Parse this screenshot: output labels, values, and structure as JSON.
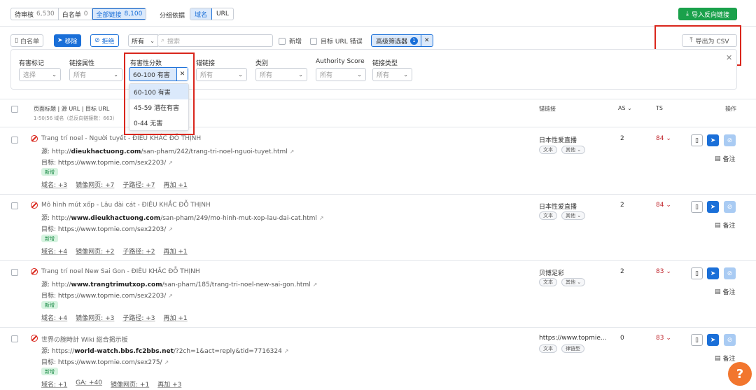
{
  "tabs": {
    "pending": {
      "label": "待审核",
      "count": "6,530"
    },
    "whitelist": {
      "label": "白名单",
      "count": "0"
    },
    "all": {
      "label": "全部链接",
      "count": "8,100"
    }
  },
  "group": {
    "label": "分组依据",
    "domain": "域名",
    "url": "URL"
  },
  "import_label": "导入反向链接",
  "toolbar": {
    "whitelist": "白名单",
    "remove": "移除",
    "reject": "拒绝",
    "scope": "所有",
    "search_placeholder": "搜索",
    "new": "新增",
    "target_error": "目标 URL 错误",
    "advanced": "高级筛选器",
    "advanced_count": "1",
    "export": "导出为 CSV"
  },
  "filters": {
    "toxic_mark": {
      "label": "有害标记",
      "value": "选择"
    },
    "link_attr": {
      "label": "链接属性",
      "value": "所有"
    },
    "toxic_score": {
      "label": "有害性分数",
      "value": "60-100 有害"
    },
    "anchor": {
      "label": "锚链接",
      "value": "所有"
    },
    "category": {
      "label": "类别",
      "value": "所有"
    },
    "authority": {
      "label": "Authority Score",
      "value": "所有"
    },
    "link_type": {
      "label": "链接类型",
      "value": "所有"
    }
  },
  "dropdown": [
    "60-100 有害",
    "45-59 潜在有害",
    "0-44 无害"
  ],
  "table": {
    "col_page": "页面标题 | 源 URL | 目标 URL",
    "col_page_sub": "1-50/56 域名（总反向链接数：663）",
    "col_anchor": "锚链接",
    "col_as": "AS",
    "col_ts": "TS",
    "col_actions": "操作"
  },
  "labels": {
    "src": "源:",
    "target": "目标:",
    "new_tag": "新增",
    "note": "备注"
  },
  "rows": [
    {
      "title": "Trang trí noel - Người tuyết - ĐIÊU KHẮC ĐỖ THỊNH",
      "src_pre": "http://",
      "src_domain": "dieukhactuong.com",
      "src_path": "/san-pham/242/trang-tri-noel-nguoi-tuyet.html",
      "target": "https://www.topmie.com/sex2203/",
      "anchor": "日本性爱直播",
      "pill1": "文本",
      "pill2": "其他",
      "as": "2",
      "ts": "84",
      "links": [
        "域名: +3",
        "镜像网页: +7",
        "子路径: +7",
        "再加 +1"
      ]
    },
    {
      "title": "Mô hình mút xốp - Lâu đài cát - ĐIÊU KHẮC ĐỖ THỊNH",
      "src_pre": "http://",
      "src_domain": "www.dieukhactuong.com",
      "src_path": "/san-pham/249/mo-hinh-mut-xop-lau-dai-cat.html",
      "target": "https://www.topmie.com/sex2203/",
      "anchor": "日本性爱直播",
      "pill1": "文本",
      "pill2": "其他",
      "as": "2",
      "ts": "84",
      "links": [
        "域名: +4",
        "镜像网页: +2",
        "子路径: +2",
        "再加 +1"
      ]
    },
    {
      "title": "Trang trí noel New Sai Gon - ĐIÊU KHẮC ĐỖ THỊNH",
      "src_pre": "http://",
      "src_domain": "www.trangtrimutxop.com",
      "src_path": "/san-pham/185/trang-tri-noel-new-sai-gon.html",
      "target": "https://www.topmie.com/sex2203/",
      "anchor": "贝博足彩",
      "pill1": "文本",
      "pill2": "其他",
      "as": "2",
      "ts": "83",
      "links": [
        "域名: +4",
        "镜像网页: +3",
        "子路径: +3",
        "再加 +1"
      ]
    },
    {
      "title": "世界の腕時計 Wiki 総合掲示板",
      "src_pre": "https://",
      "src_domain": "world-watch.bbs.fc2bbs.net",
      "src_path": "/?2ch=1&act=reply&tid=7716324",
      "target": "https://www.topmie.com/sex275/",
      "anchor": "https://www.topmie...",
      "pill1": "文本",
      "pill2": "律链型",
      "as": "0",
      "ts": "83",
      "links": [
        "域名: +1",
        "GA: +40",
        "镜像网页: +1",
        "再加 +3"
      ]
    }
  ]
}
